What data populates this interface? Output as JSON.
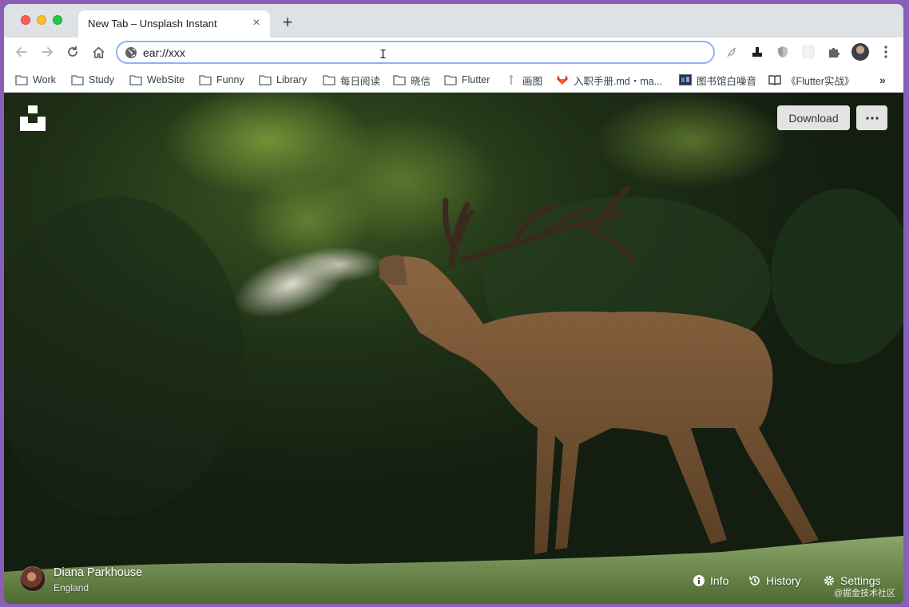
{
  "tab": {
    "title": "New Tab – Unsplash Instant",
    "close_glyph": "×",
    "new_tab_glyph": "+"
  },
  "toolbar": {
    "back_icon": "arrow-left-icon",
    "forward_icon": "arrow-right-icon",
    "reload_icon": "reload-icon",
    "home_icon": "home-icon",
    "address_value": "ear://xxx",
    "address_icon": "globe-icon",
    "extensions": [
      "feather-icon",
      "stamp-icon",
      "shield-icon",
      "blank-extension-icon",
      "puzzle-icon"
    ],
    "profile_icon": "profile-avatar",
    "menu_icon": "kebab-icon",
    "accent": "#8ab4f8"
  },
  "bookmarks": {
    "items": [
      {
        "label": "Work",
        "icon": "folder-icon"
      },
      {
        "label": "Study",
        "icon": "folder-icon"
      },
      {
        "label": "WebSite",
        "icon": "folder-icon"
      },
      {
        "label": "Funny",
        "icon": "folder-icon"
      },
      {
        "label": "Library",
        "icon": "folder-icon"
      },
      {
        "label": "每日阅读",
        "icon": "folder-icon"
      },
      {
        "label": "晓信",
        "icon": "folder-icon"
      },
      {
        "label": "Flutter",
        "icon": "folder-icon"
      },
      {
        "label": "画图",
        "icon": "pen-icon"
      },
      {
        "label": "入职手册.md・ma...",
        "icon": "gitlab-icon"
      },
      {
        "label": "图书馆白噪音",
        "icon": "image-thumb-icon"
      },
      {
        "label": "《Flutter实战》",
        "icon": "book-icon"
      }
    ],
    "overflow_glyph": "»"
  },
  "content": {
    "logo_icon": "unsplash-logo-icon",
    "download_label": "Download",
    "more_icon": "more-dots-icon",
    "author": {
      "name": "Diana Parkhouse",
      "location": "England"
    },
    "links": {
      "info": "Info",
      "history": "History",
      "settings": "Settings"
    },
    "watermark": "@掘金技术社区"
  }
}
